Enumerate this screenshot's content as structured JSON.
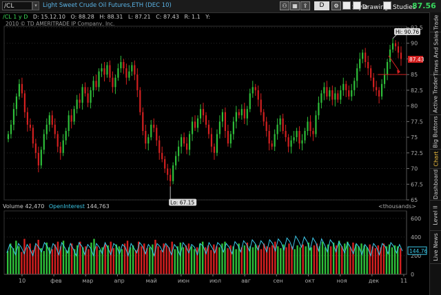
{
  "toolbar": {
    "symbol": "/CL",
    "description": "Light Sweet Crude Oil Futures,ETH (DEC 10)",
    "period_selected": "D",
    "style_label": "Style",
    "drawings_label": "Drawings",
    "studies_label": "Studies",
    "last_price": "87.56",
    "icons": [
      "link-icon",
      "grid-icon",
      "share-icon",
      "settings-icon"
    ]
  },
  "info": {
    "symbol_period": "/CL 1 y D",
    "d": "D: 15.12.10",
    "o": "O: 88.28",
    "h": "H: 88.31",
    "l": "L: 87.21",
    "c": "C: 87.43",
    "r": "R: 1.1",
    "y": "Y:"
  },
  "copyright": "2010 © TD AMERITRADE IP Company, Inc.",
  "price_axis": [
    "92.5",
    "90",
    "87.5",
    "85",
    "82.5",
    "80",
    "77.5",
    "75",
    "72.5",
    "70",
    "67.5",
    "65"
  ],
  "current_price_label": "87.43",
  "hi_label": "Hi: 90.76",
  "lo_label": "Lo: 67.15",
  "volume_bar": {
    "label": "Volume",
    "value": "42,470",
    "oi_label": "OpenInterest",
    "oi_value": "144,763",
    "units": "<thousands>"
  },
  "volume_axis": [
    "600",
    "400",
    "200",
    "0"
  ],
  "oi_current": "144.76",
  "months": [
    "10",
    "фев",
    "мар",
    "апр",
    "май",
    "июн",
    "июл",
    "авг",
    "сен",
    "окт",
    "ноя",
    "дек",
    "11"
  ],
  "sidebar_tabs": [
    "Trade",
    "Times And Sales",
    "Active Trader",
    "Big Buttons",
    "Chart",
    "Dashboard",
    "Level II",
    "Live News"
  ],
  "active_tab": "Chart",
  "colors": {
    "up": "#2fbf3a",
    "down": "#d42020",
    "oi": "#3cc8e8",
    "accent": "#f0c040",
    "price": "#37d65d"
  },
  "chart_data": {
    "type": "candlestick",
    "title": "Light Sweet Crude Oil Futures,ETH (DEC 10)",
    "ylim": [
      65,
      92.5
    ],
    "hi": 90.76,
    "lo": 67.15,
    "last": 87.43,
    "closes": [
      75.5,
      77,
      79.5,
      81.5,
      83.5,
      82,
      79,
      77,
      76.5,
      74,
      72.5,
      70.5,
      73,
      75.5,
      77,
      78.5,
      77,
      75.5,
      73.5,
      72.5,
      74.5,
      76,
      78.5,
      77.5,
      79.5,
      81,
      80.5,
      83,
      82,
      80.5,
      82.5,
      84,
      83,
      85.5,
      86,
      85,
      86.5,
      84.5,
      83,
      84.5,
      86,
      87,
      86,
      84.5,
      85.5,
      86.5,
      85,
      82.5,
      79,
      76,
      74,
      75,
      77,
      76.5,
      74.5,
      72.5,
      71.5,
      70,
      69,
      68,
      70.5,
      72,
      73.5,
      75,
      74,
      73,
      75.5,
      77.5,
      76.5,
      78,
      79.5,
      78.5,
      77,
      75.5,
      73.5,
      72.5,
      75.5,
      77.5,
      79,
      76,
      74,
      75.5,
      77.5,
      79,
      78.5,
      79.5,
      78,
      79.5,
      82,
      83,
      82.5,
      81,
      79,
      77.5,
      76,
      74,
      73.5,
      75.5,
      77,
      78,
      76,
      75,
      73.5,
      74.5,
      75,
      76,
      74,
      74.5,
      76,
      77.5,
      76,
      75.5,
      78.5,
      80.5,
      82,
      83,
      81.5,
      82.5,
      81,
      82,
      81,
      82.5,
      83.5,
      82.5,
      81.5,
      82.5,
      84,
      86,
      87.5,
      88.5,
      87,
      86,
      84.5,
      83,
      82.5,
      81.5,
      83.5,
      85,
      87,
      89,
      90,
      89.5,
      88.5,
      87.5
    ],
    "volume": [
      250,
      330,
      280,
      360,
      300,
      240,
      380,
      290,
      330,
      260,
      310,
      370,
      280,
      250,
      340,
      290,
      270,
      320,
      350,
      300,
      360,
      260,
      290,
      330,
      270,
      310,
      350,
      290,
      300,
      270,
      340,
      380,
      300,
      260,
      290,
      330,
      310,
      350,
      280,
      320,
      300,
      270,
      330,
      360,
      290,
      310,
      260,
      350,
      300,
      330,
      280,
      290,
      320,
      370,
      300,
      260,
      330,
      310,
      290,
      350,
      270,
      300,
      340,
      290,
      310,
      330,
      300,
      270,
      290,
      330,
      350,
      290,
      310,
      260,
      320,
      300,
      290,
      330,
      350,
      280,
      310,
      300,
      270,
      330,
      290,
      310,
      340,
      300,
      290,
      320,
      310,
      270,
      330,
      300,
      290,
      310,
      350,
      300,
      280,
      320,
      290,
      330,
      300,
      270,
      310,
      290,
      320,
      300,
      340,
      290,
      310,
      330,
      300,
      350,
      290,
      320,
      300,
      340,
      310,
      360,
      300,
      330,
      350,
      290,
      340,
      320,
      300,
      330,
      310,
      290,
      320,
      300,
      280,
      310,
      290,
      330,
      300,
      320,
      290,
      310,
      300,
      280
    ],
    "open_interest": [
      230,
      320,
      280,
      210,
      330,
      290,
      220,
      320,
      270,
      200,
      330,
      290,
      240,
      340,
      300,
      220,
      330,
      290,
      210,
      340,
      290,
      230,
      330,
      270,
      200,
      340,
      300,
      210,
      320,
      280,
      200,
      330,
      290,
      220,
      340,
      280,
      210,
      330,
      300,
      220,
      320,
      290,
      200,
      330,
      280,
      230,
      340,
      300,
      220,
      320,
      280,
      200,
      330,
      300,
      240,
      330,
      290,
      210,
      320,
      280,
      200,
      340,
      300,
      230,
      320,
      290,
      210,
      330,
      300,
      220,
      340,
      290,
      230,
      340,
      310,
      240,
      330,
      290,
      220,
      350,
      310,
      240,
      360,
      320,
      250,
      370,
      330,
      260,
      360,
      320,
      240,
      370,
      330,
      250,
      380,
      340,
      260,
      390,
      350,
      270,
      410,
      360,
      290,
      400,
      350,
      260,
      390,
      340,
      250,
      380,
      320,
      240,
      370,
      330,
      240,
      350,
      300,
      230,
      340,
      290,
      220,
      330,
      290,
      210,
      320,
      280,
      200,
      330,
      290,
      210,
      330,
      300,
      220,
      340,
      300,
      230,
      320,
      250
    ]
  }
}
